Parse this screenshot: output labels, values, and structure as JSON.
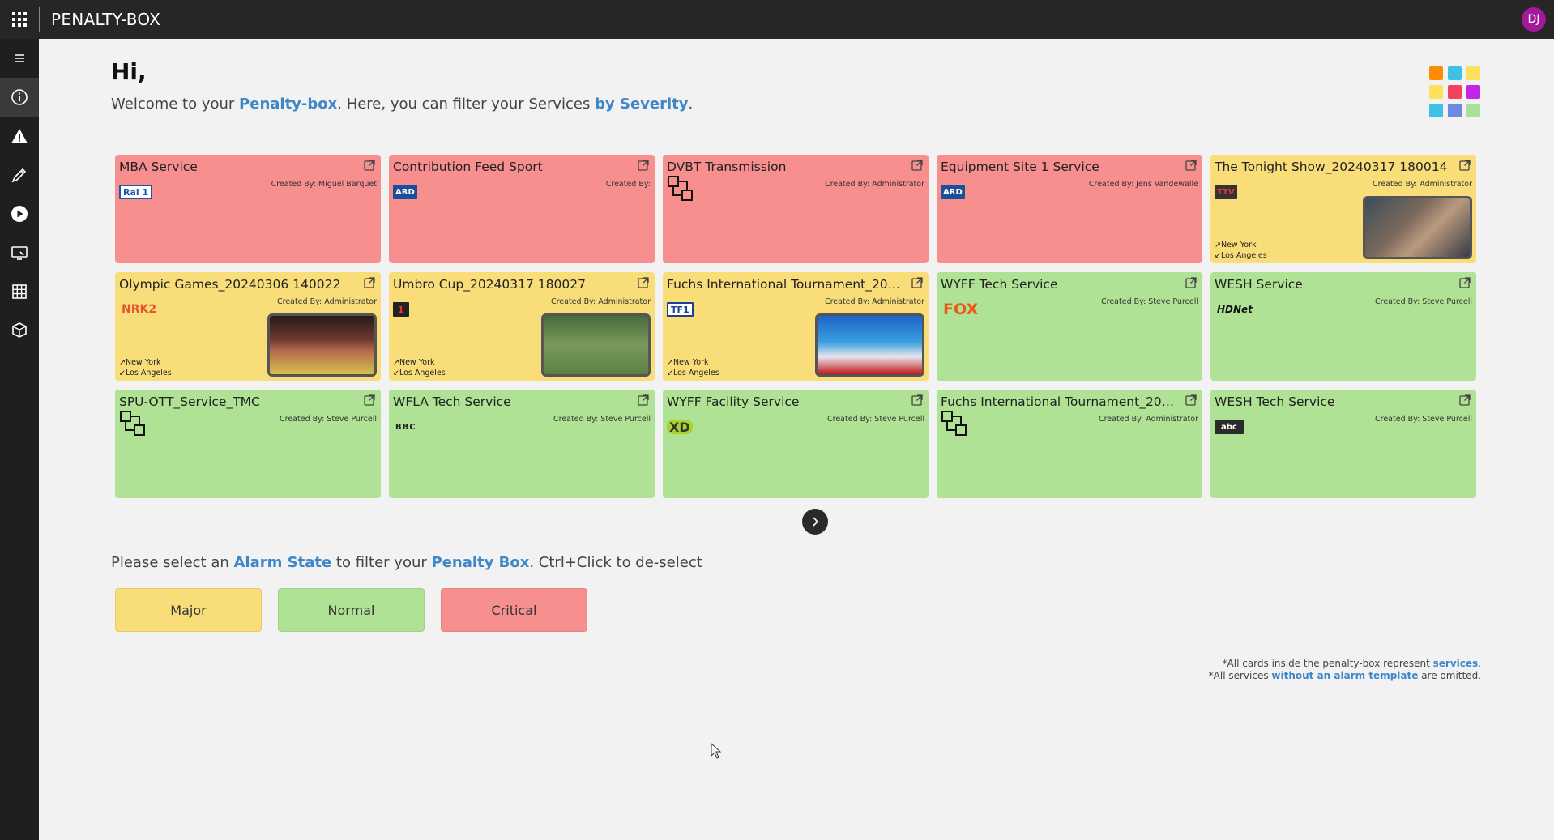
{
  "app": {
    "title": "PENALTY-BOX",
    "user_initials": "DJ"
  },
  "sidebar": {
    "items": [
      {
        "name": "menu",
        "icon": "hamburger-icon"
      },
      {
        "name": "info",
        "icon": "info-icon",
        "active": true
      },
      {
        "name": "alarms",
        "icon": "warning-icon"
      },
      {
        "name": "tools",
        "icon": "pencil-icon"
      },
      {
        "name": "play",
        "icon": "play-icon"
      },
      {
        "name": "monitor",
        "icon": "monitor-icon"
      },
      {
        "name": "grid",
        "icon": "table-grid-icon"
      },
      {
        "name": "packages",
        "icon": "package-icon"
      }
    ]
  },
  "main": {
    "greeting": "Hi,",
    "welcome": {
      "part1": "Welcome to your ",
      "link1": "Penalty-box",
      "part2": ". Here, you can filter your Services ",
      "link2": "by Severity",
      "part3": "."
    }
  },
  "cards": [
    {
      "title": "MBA Service",
      "state": "critical",
      "created_by": "Created By: Miguel Barquet",
      "logo": "Rai 1"
    },
    {
      "title": "Contribution Feed Sport",
      "state": "critical",
      "created_by": "Created By:",
      "logo": "ARD"
    },
    {
      "title": "DVBT Transmission",
      "state": "critical",
      "created_by": "Created By: Administrator",
      "logo": ""
    },
    {
      "title": "Equipment Site 1 Service",
      "state": "critical",
      "created_by": "Created By: Jens Vandewalle",
      "logo": "ARD"
    },
    {
      "title": "The Tonight Show_20240317 180014",
      "state": "major",
      "created_by": "Created By: Administrator",
      "logo": "TTV",
      "from": "New York",
      "to": "Los Angeles"
    },
    {
      "title": "Olympic Games_20240306 140022",
      "state": "major",
      "created_by": "Created By: Administrator",
      "logo": "NRK2",
      "from": "New York",
      "to": "Los Angeles"
    },
    {
      "title": "Umbro Cup_20240317 180027",
      "state": "major",
      "created_by": "Created By: Administrator",
      "logo": "1",
      "from": "New York",
      "to": "Los Angeles"
    },
    {
      "title": "Fuchs International Tournament_202403...",
      "state": "major",
      "created_by": "Created By: Administrator",
      "logo": "TF1",
      "from": "New York",
      "to": "Los Angeles"
    },
    {
      "title": "WYFF Tech Service",
      "state": "normal",
      "created_by": "Created By: Steve Purcell",
      "logo": "FOX"
    },
    {
      "title": "WESH Service",
      "state": "normal",
      "created_by": "Created By: Steve Purcell",
      "logo": "HDNet"
    },
    {
      "title": "SPU-OTT_Service_TMC",
      "state": "normal",
      "created_by": "Created By: Steve Purcell",
      "logo": ""
    },
    {
      "title": "WFLA Tech Service",
      "state": "normal",
      "created_by": "Created By: Steve Purcell",
      "logo": "BBC"
    },
    {
      "title": "WYFF Facility Service",
      "state": "normal",
      "created_by": "Created By: Steve Purcell",
      "logo": "XD"
    },
    {
      "title": "Fuchs International Tournament_202403...",
      "state": "normal",
      "created_by": "Created By: Administrator",
      "logo": ""
    },
    {
      "title": "WESH Tech Service",
      "state": "normal",
      "created_by": "Created By: Steve Purcell",
      "logo": "abc"
    }
  ],
  "filter": {
    "prompt": {
      "part1": "Please select an ",
      "link1": "Alarm State",
      "part2": " to filter your ",
      "link2": "Penalty Box",
      "part3": ". Ctrl+Click to de-select"
    },
    "buttons": {
      "major": "Major",
      "normal": "Normal",
      "critical": "Critical"
    }
  },
  "footnote": {
    "line1_part1": "*All cards inside the penalty-box represent ",
    "line1_link": "services",
    "line1_part2": ".",
    "line2_part1": "*All services ",
    "line2_link": "without an alarm template",
    "line2_part2": " are omitted."
  },
  "colors": {
    "critical": "#f88f8f",
    "major": "#f9dd79",
    "normal": "#b0e295",
    "link": "#3f86c9",
    "topbar": "#262626",
    "avatar": "#a4199c"
  }
}
